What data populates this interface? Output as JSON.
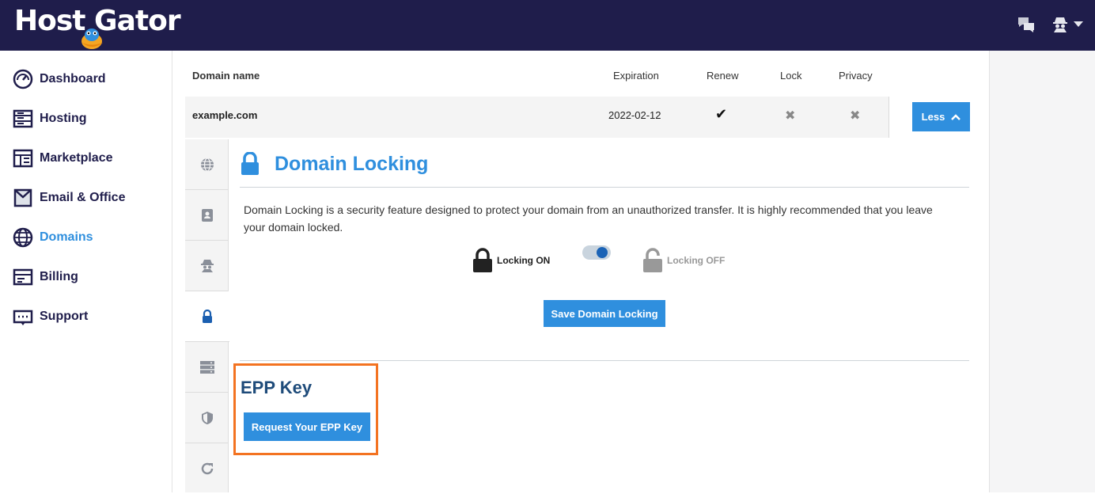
{
  "brand": {
    "logo_text": "Host Gator",
    "topbar_color": "#1f1d4b",
    "accent": "#2f8fde",
    "highlight": "#f37321"
  },
  "topbar": {
    "icons": [
      "chat-icon",
      "user-spy-icon",
      "caret-down-icon"
    ]
  },
  "sidebar": {
    "items": [
      {
        "label": "Dashboard",
        "icon": "dashboard-icon"
      },
      {
        "label": "Hosting",
        "icon": "hosting-icon"
      },
      {
        "label": "Marketplace",
        "icon": "marketplace-icon"
      },
      {
        "label": "Email & Office",
        "icon": "email-icon"
      },
      {
        "label": "Domains",
        "icon": "globe-icon",
        "active": true
      },
      {
        "label": "Billing",
        "icon": "billing-icon"
      },
      {
        "label": "Support",
        "icon": "support-icon"
      }
    ]
  },
  "table": {
    "headers": {
      "domain": "Domain name",
      "expiration": "Expiration",
      "renew": "Renew",
      "lock": "Lock",
      "privacy": "Privacy"
    },
    "row": {
      "domain": "example.com",
      "expiration": "2022-02-12",
      "renew": "✔",
      "lock": "✖",
      "privacy": "✖"
    },
    "less_label": "Less"
  },
  "vertical_tabs": [
    "globe-icon",
    "contact-card-icon",
    "spy-icon",
    "lock-icon",
    "server-icon",
    "shield-icon",
    "refresh-icon"
  ],
  "locking": {
    "title": "Domain Locking",
    "description": "Domain Locking is a security feature designed to protect your domain from an unauthorized transfer. It is highly recommended that you leave your domain locked.",
    "on_label": "Locking ON",
    "off_label": "Locking OFF",
    "toggle_state": "on",
    "save_label": "Save Domain Locking"
  },
  "epp": {
    "title": "EPP Key",
    "button_label": "Request Your EPP Key"
  }
}
